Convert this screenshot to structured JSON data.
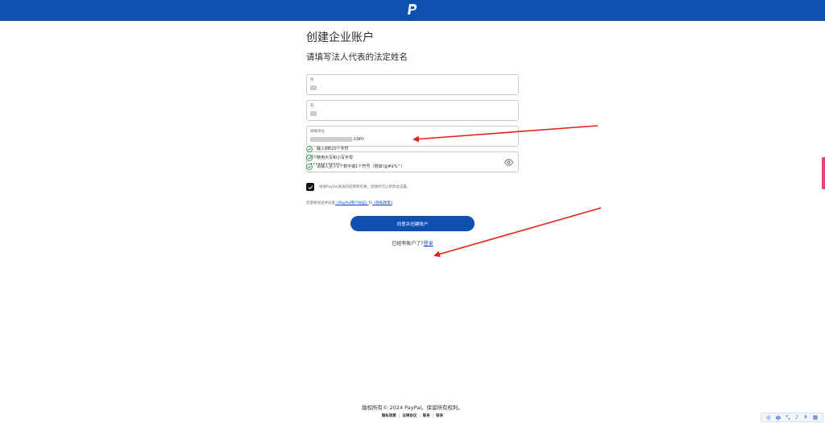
{
  "header": {
    "logo_icon": "paypal-logo-icon",
    "color": "#0e4fb2"
  },
  "page": {
    "title": "创建企业账户",
    "subtitle": "请填写法人代表的法定姓名"
  },
  "form": {
    "last_name": {
      "label": "姓",
      "value": ""
    },
    "first_name": {
      "label": "名",
      "value": ""
    },
    "email": {
      "label": "邮箱地址",
      "value_suffix": ".com"
    },
    "password": {
      "label": "密码",
      "value": "••••••••••••"
    }
  },
  "password_rules": [
    "输入8到20个字符",
    "使用大写和小写字母",
    "请输入至少1个数字或1个符号（例如!@#$%^）"
  ],
  "consent": {
    "checked": true,
    "text": "接收PayPal发送的促销和优惠。您随时可以更改此设置。"
  },
  "agreement": {
    "prefix": "您需要阅读并同意",
    "user_agreement": "《PayPal用户协议》",
    "and": "和",
    "privacy": "《隐私政策》",
    "suffix": "。"
  },
  "cta": {
    "label": "同意并创建账户"
  },
  "login": {
    "prompt": "已经有账户了?",
    "link": "登录"
  },
  "footer": {
    "copyright": "版权所有© 2024 PayPal。保留所有权利。",
    "links": [
      "隐私政策",
      "法律协议",
      "联系",
      "联系"
    ]
  },
  "tray": {
    "ime": "中"
  }
}
